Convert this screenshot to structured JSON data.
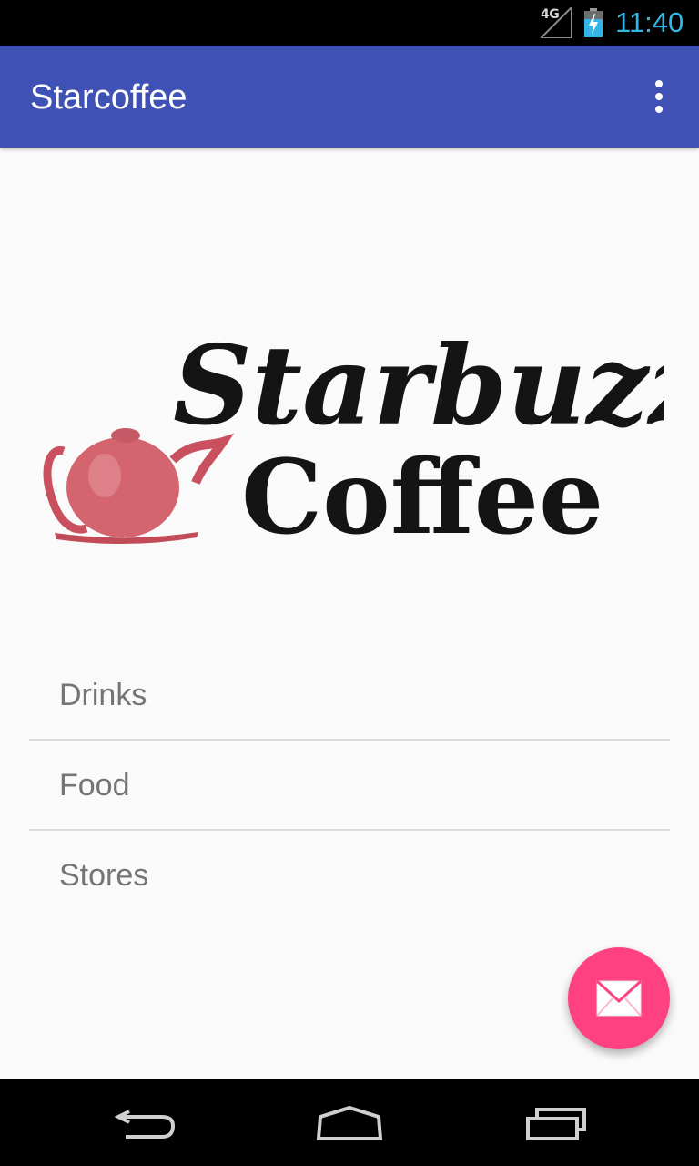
{
  "status_bar": {
    "network": "4G",
    "time": "11:40",
    "icons": [
      "signal-icon",
      "battery-charging-icon"
    ]
  },
  "app_bar": {
    "title": "Starcoffee",
    "overflow_icon": "more-vert-icon"
  },
  "logo": {
    "line1": "Starbuzz",
    "line2": "Coffee",
    "image_icon": "teapot-icon"
  },
  "menu": {
    "items": [
      {
        "label": "Drinks"
      },
      {
        "label": "Food"
      },
      {
        "label": "Stores"
      }
    ]
  },
  "fab": {
    "icon": "mail-icon",
    "color": "#ff4081"
  },
  "nav_bar": {
    "icons": [
      "back-icon",
      "home-icon",
      "recents-icon"
    ]
  },
  "colors": {
    "primary": "#3f51b5",
    "accent": "#ff4081",
    "clock": "#33b5e5"
  }
}
